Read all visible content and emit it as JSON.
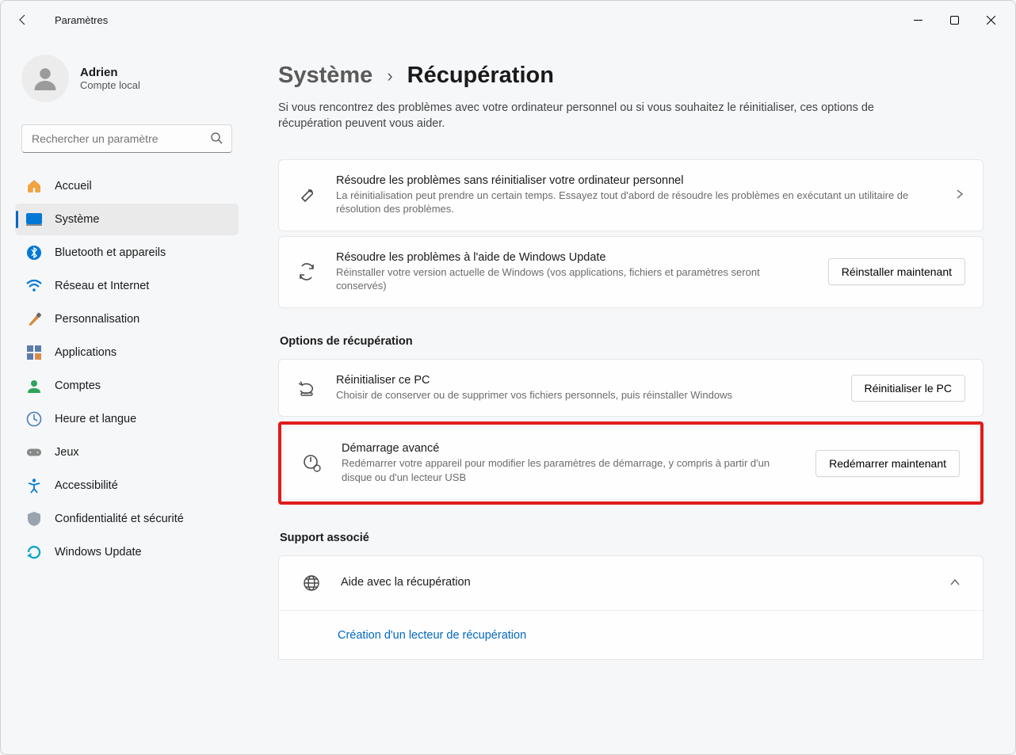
{
  "window": {
    "title": "Paramètres"
  },
  "profile": {
    "name": "Adrien",
    "subtitle": "Compte local"
  },
  "search": {
    "placeholder": "Rechercher un paramètre"
  },
  "nav": {
    "items": [
      {
        "label": "Accueil"
      },
      {
        "label": "Système"
      },
      {
        "label": "Bluetooth et appareils"
      },
      {
        "label": "Réseau et Internet"
      },
      {
        "label": "Personnalisation"
      },
      {
        "label": "Applications"
      },
      {
        "label": "Comptes"
      },
      {
        "label": "Heure et langue"
      },
      {
        "label": "Jeux"
      },
      {
        "label": "Accessibilité"
      },
      {
        "label": "Confidentialité et sécurité"
      },
      {
        "label": "Windows Update"
      }
    ]
  },
  "breadcrumb": {
    "parent": "Système",
    "current": "Récupération"
  },
  "intro": "Si vous rencontrez des problèmes avec votre ordinateur personnel ou si vous souhaitez le réinitialiser, ces options de récupération peuvent vous aider.",
  "cards": {
    "troubleshoot": {
      "title": "Résoudre les problèmes sans réinitialiser votre ordinateur personnel",
      "desc": "La réinitialisation peut prendre un certain temps. Essayez tout d'abord de résoudre les problèmes en exécutant un utilitaire de résolution des problèmes."
    },
    "winupdate": {
      "title": "Résoudre les problèmes à l'aide de Windows Update",
      "desc": "Réinstaller votre version actuelle de Windows (vos applications, fichiers et paramètres seront conservés)",
      "button": "Réinstaller maintenant"
    },
    "section_recovery": "Options de récupération",
    "reset": {
      "title": "Réinitialiser ce PC",
      "desc": "Choisir de conserver ou de supprimer vos fichiers personnels, puis réinstaller Windows",
      "button": "Réinitialiser le PC"
    },
    "advanced": {
      "title": "Démarrage avancé",
      "desc": "Redémarrer votre appareil pour modifier les paramètres de démarrage, y compris à partir d'un disque ou d'un lecteur USB",
      "button": "Redémarrer maintenant"
    },
    "section_support": "Support associé",
    "help": {
      "title": "Aide avec la récupération"
    },
    "recovery_drive_link": "Création d'un lecteur de récupération"
  }
}
